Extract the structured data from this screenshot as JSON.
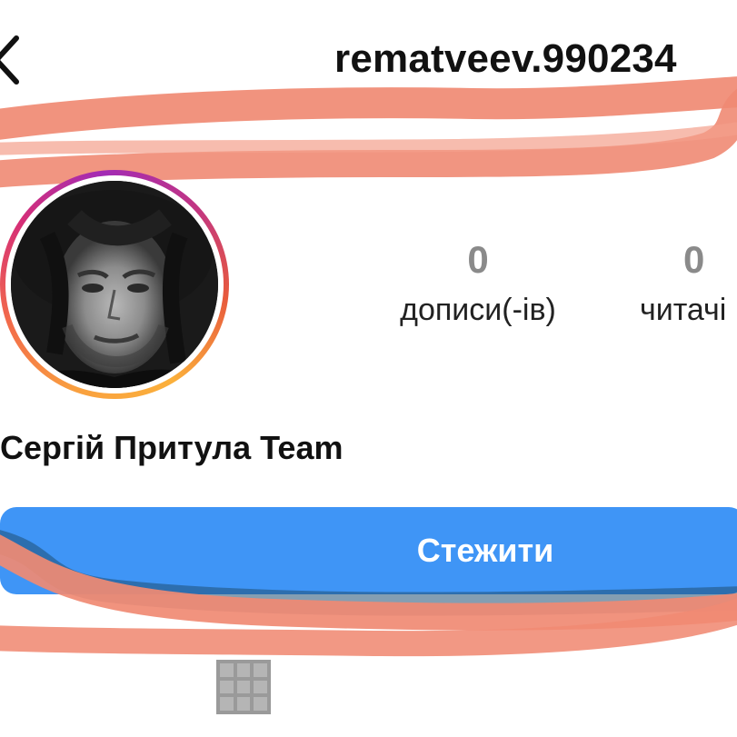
{
  "header": {
    "back_icon": "chevron-left-icon",
    "username": "rematveev.990234"
  },
  "profile": {
    "avatar_icon": "profile-photo",
    "display_name": "Сергій Притула Team",
    "stats": {
      "posts_count": "0",
      "posts_label": "дописи(-ів)",
      "followers_count": "0",
      "followers_label": "читачі"
    }
  },
  "actions": {
    "follow_label": "Стежити"
  },
  "tabs": {
    "grid_icon": "grid-icon"
  },
  "colors": {
    "follow_button": "#3f95f6",
    "scribble": "#f08a73",
    "story_ring_start": "#f9a03f",
    "story_ring_end": "#a22bb5"
  }
}
